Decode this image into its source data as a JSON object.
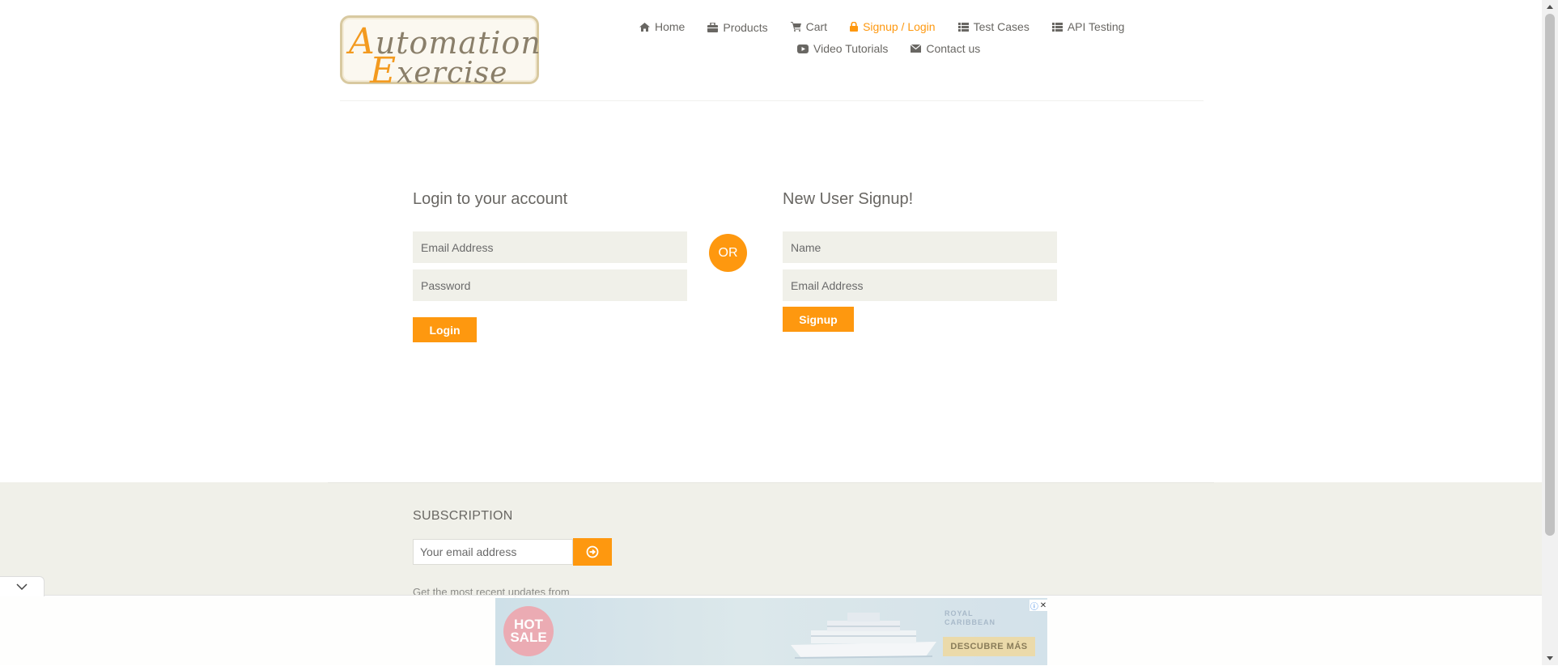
{
  "logo": {
    "line1_cap": "A",
    "line1_rest": "utomation",
    "line2_cap": "E",
    "line2_rest": "xercise"
  },
  "nav": {
    "items": [
      {
        "label": "Home",
        "icon": "home-icon"
      },
      {
        "label": "Products",
        "icon": "briefcase-icon"
      },
      {
        "label": "Cart",
        "icon": "cart-icon"
      },
      {
        "label": "Signup / Login",
        "icon": "lock-icon",
        "active": true
      },
      {
        "label": "Test Cases",
        "icon": "list-icon"
      },
      {
        "label": "API Testing",
        "icon": "list-icon"
      },
      {
        "label": "Video Tutorials",
        "icon": "youtube-play-icon"
      },
      {
        "label": "Contact us",
        "icon": "envelope-icon"
      }
    ]
  },
  "login": {
    "title": "Login to your account",
    "email_placeholder": "Email Address",
    "password_placeholder": "Password",
    "button": "Login"
  },
  "or_label": "OR",
  "signup": {
    "title": "New User Signup!",
    "name_placeholder": "Name",
    "email_placeholder": "Email Address",
    "button": "Signup"
  },
  "footer": {
    "subscription_title": "SUBSCRIPTION",
    "email_placeholder": "Your email address",
    "subscribe_icon": "arrow-circle-right-icon",
    "text": "Get the most recent updates from"
  },
  "ad": {
    "logo_line1": "HOT",
    "logo_line2": "SALE",
    "brand_line1": "ROYAL",
    "brand_line2": "CARIBBEAN",
    "cta": "DESCUBRE MÁS"
  },
  "colors": {
    "accent": "#fe980f",
    "field_bg": "#f0f0e9",
    "text": "#696763"
  }
}
